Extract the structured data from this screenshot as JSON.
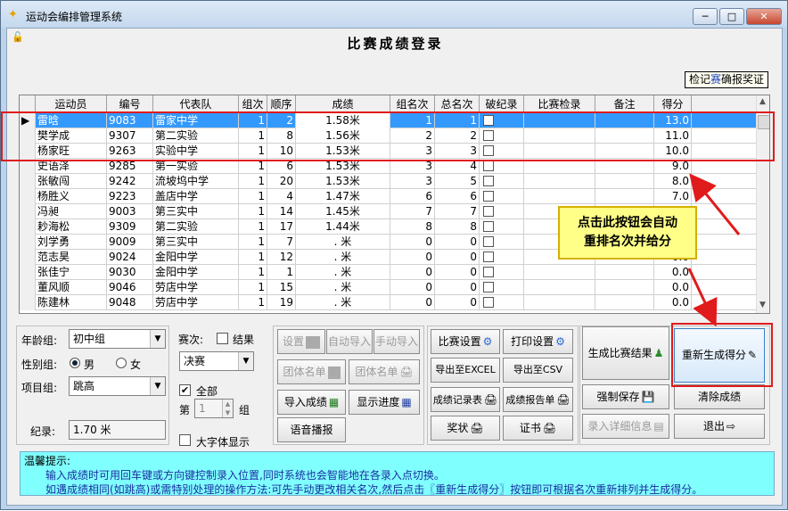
{
  "window": {
    "title": "运动会编排管理系统",
    "min": "─",
    "max": "□",
    "close": "✕"
  },
  "form_title": "比赛成绩登录",
  "confirm_button": {
    "pre": "检记",
    "mid": "赛",
    "post": "确报奖证"
  },
  "table": {
    "headers": [
      "运动员",
      "编号",
      "代表队",
      "组次",
      "顺序",
      "成绩",
      "组名次",
      "总名次",
      "破纪录",
      "比赛检录",
      "备注",
      "得分"
    ],
    "rows": [
      [
        "雷晗",
        "9083",
        "雷家中学",
        "1",
        "2",
        "1.58米",
        "1",
        "1",
        "",
        "",
        "",
        "13.0"
      ],
      [
        "樊学成",
        "9307",
        "第二实验",
        "1",
        "8",
        "1.56米",
        "2",
        "2",
        "",
        "",
        "",
        "11.0"
      ],
      [
        "杨家旺",
        "9263",
        "实验中学",
        "1",
        "10",
        "1.53米",
        "3",
        "3",
        "",
        "",
        "",
        "10.0"
      ],
      [
        "史语泽",
        "9285",
        "第一实验",
        "1",
        "6",
        "1.53米",
        "3",
        "4",
        "",
        "",
        "",
        "9.0"
      ],
      [
        "张敏闯",
        "9242",
        "流坡坞中学",
        "1",
        "20",
        "1.53米",
        "3",
        "5",
        "",
        "",
        "",
        "8.0"
      ],
      [
        "杨胜义",
        "9223",
        "盖店中学",
        "1",
        "4",
        "1.47米",
        "6",
        "6",
        "",
        "",
        "",
        "7.0"
      ],
      [
        "冯昶",
        "9003",
        "第三实中",
        "1",
        "14",
        "1.45米",
        "7",
        "7",
        "",
        "",
        "",
        "6.0"
      ],
      [
        "耖海松",
        "9309",
        "第二实验",
        "1",
        "17",
        "1.44米",
        "8",
        "8",
        "",
        "",
        "",
        "5.0"
      ],
      [
        "刘学勇",
        "9009",
        "第三实中",
        "1",
        "7",
        ".  米",
        "0",
        "0",
        "",
        "",
        "",
        "0.0"
      ],
      [
        "范志昊",
        "9024",
        "金阳中学",
        "1",
        "12",
        ".  米",
        "0",
        "0",
        "",
        "",
        "",
        "0.0"
      ],
      [
        "张佳宁",
        "9030",
        "金阳中学",
        "1",
        "1",
        ".  米",
        "0",
        "0",
        "",
        "",
        "",
        "0.0"
      ],
      [
        "董风顺",
        "9046",
        "劳店中学",
        "1",
        "15",
        ".  米",
        "0",
        "0",
        "",
        "",
        "",
        "0.0"
      ],
      [
        "陈建林",
        "9048",
        "劳店中学",
        "1",
        "19",
        ".  米",
        "0",
        "0",
        "",
        "",
        "",
        "0.0"
      ]
    ]
  },
  "callout": {
    "line1": "点击此按钮会自动",
    "line2": "重排名次并给分"
  },
  "filters": {
    "age_label": "年龄组:",
    "age_value": "初中组",
    "gender_label": "性别组:",
    "male": "男",
    "female": "女",
    "event_label": "项目组:",
    "event_value": "跳高",
    "record_label": "纪录:",
    "record_value": "1.70 米"
  },
  "round": {
    "label": "赛次:",
    "final_label": "结果",
    "value": "决赛",
    "all_label": "全部",
    "group_pre": "第",
    "group_value": "1",
    "group_post": "组",
    "bigfont_label": "大字体显示"
  },
  "buttons": {
    "setup": "设置",
    "auto_import": "自动导入",
    "manual_import": "手动导入",
    "team_list1": "团体名单",
    "team_list2": "团体名单",
    "import_results": "导入成绩",
    "show_progress": "显示进度",
    "voice": "语音播报",
    "match_setup": "比赛设置",
    "print_setup": "打印设置",
    "export_excel": "导出至EXCEL",
    "export_csv": "导出至CSV",
    "result_table": "成绩记录表",
    "result_report": "成绩报告单",
    "award": "奖状",
    "certificate": "证书",
    "gen_results": "生成比赛结果",
    "regen_score": "重新生成得分",
    "force_save": "强制保存",
    "clear": "清除成绩",
    "detail_entry": "录入详细信息",
    "exit": "退出"
  },
  "hint": {
    "title": "温馨提示:",
    "line1": "输入成绩时可用回车键或方向键控制录入位置,同时系统也会智能地在各录入点切换。",
    "line2": "如遇成绩相同(如跳高)或需特别处理的操作方法:可先手动更改相关名次,然后点击〖重新生成得分〗按钮即可根据名次重新排列并生成得分。"
  },
  "colors": {
    "selected_row": "#3399ff",
    "highlight": "#e01b1b",
    "callout": "#ffff88",
    "hint_bg": "#80ffff"
  }
}
